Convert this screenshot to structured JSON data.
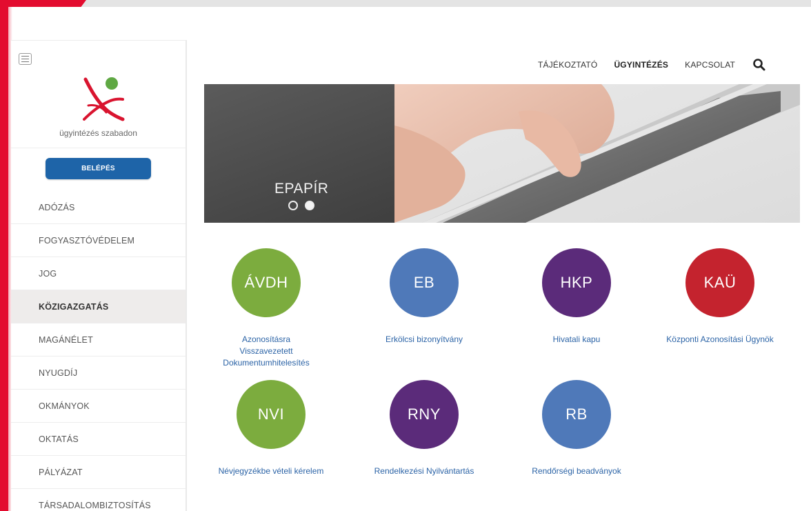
{
  "logo": {
    "caption": "ügyintézés szabadon"
  },
  "sidebar": {
    "login_label": "BELÉPÉS",
    "items": [
      {
        "label": "ADÓZÁS",
        "active": false
      },
      {
        "label": "FOGYASZTÓVÉDELEM",
        "active": false
      },
      {
        "label": "JOG",
        "active": false
      },
      {
        "label": "KÖZIGAZGATÁS",
        "active": true
      },
      {
        "label": "MAGÁNÉLET",
        "active": false
      },
      {
        "label": "NYUGDÍJ",
        "active": false
      },
      {
        "label": "OKMÁNYOK",
        "active": false
      },
      {
        "label": "OKTATÁS",
        "active": false
      },
      {
        "label": "PÁLYÁZAT",
        "active": false
      },
      {
        "label": "TÁRSADALOMBIZTOSÍTÁS",
        "active": false
      }
    ]
  },
  "topnav": {
    "links": [
      {
        "label": "TÁJÉKOZTATÓ",
        "active": false
      },
      {
        "label": "ÜGYINTÉZÉS",
        "active": true
      },
      {
        "label": "KAPCSOLAT",
        "active": false
      }
    ],
    "search_icon": "search-icon"
  },
  "banner": {
    "caption": "EPAPÍR",
    "slides": 2,
    "active_slide": 2
  },
  "services": [
    {
      "abbr": "ÁVDH",
      "label": "Azonosításra Visszavezetett Dokumentumhitelesítés",
      "color": "#7cac3e"
    },
    {
      "abbr": "EB",
      "label": "Erkölcsi bizonyítvány",
      "color": "#4f79b9"
    },
    {
      "abbr": "HKP",
      "label": "Hivatali kapu",
      "color": "#5b2b7a"
    },
    {
      "abbr": "KAÜ",
      "label": "Központi Azonosítási Ügynök",
      "color": "#c4232e"
    },
    {
      "abbr": "NVI",
      "label": "Névjegyzékbe vételi kérelem",
      "color": "#7cac3e"
    },
    {
      "abbr": "RNY",
      "label": "Rendelkezési Nyilvántartás",
      "color": "#5b2b7a"
    },
    {
      "abbr": "RB",
      "label": "Rendőrségi beadványok",
      "color": "#4f79b9"
    }
  ],
  "colors": {
    "brand_red": "#e30c2f",
    "login_blue": "#1e64a8",
    "link_blue": "#2b63a6"
  }
}
